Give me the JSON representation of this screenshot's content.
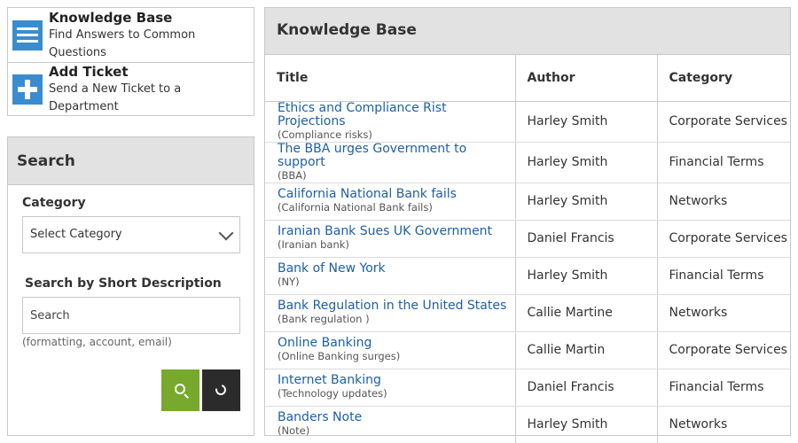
{
  "nav": {
    "items": [
      {
        "icon": "menu-icon",
        "title": "Knowledge Base",
        "subtitle": "Find Answers to Common Questions"
      },
      {
        "icon": "plus-icon",
        "title": "Add Ticket",
        "subtitle": "Send a New Ticket to a Department"
      }
    ]
  },
  "search": {
    "title": "Search",
    "category_label": "Category",
    "category_value": "Select Category",
    "desc_label": "Search by Short Description",
    "desc_placeholder": "Search",
    "hint": "(formatting, account, email)"
  },
  "kb": {
    "title": "Knowledge Base",
    "columns": [
      "Title",
      "Author",
      "Category"
    ],
    "rows": [
      {
        "title": "Ethics and Compliance Rist Projections",
        "sub": "(Compliance risks)",
        "author": "Harley Smith",
        "category": "Corporate Services"
      },
      {
        "title": "The BBA urges Government to support",
        "sub": "(BBA)",
        "author": "Harley Smith",
        "category": "Financial Terms"
      },
      {
        "title": "California National Bank fails",
        "sub": "(California National Bank fails)",
        "author": "Harley Smith",
        "category": "Networks"
      },
      {
        "title": "Iranian Bank Sues UK Government",
        "sub": "(Iranian bank)",
        "author": "Daniel Francis",
        "category": "Corporate Services"
      },
      {
        "title": "Bank of New York",
        "sub": "(NY)",
        "author": "Harley Smith",
        "category": "Financial Terms"
      },
      {
        "title": "Bank Regulation in the United States",
        "sub": "(Bank regulation )",
        "author": "Callie Martine",
        "category": "Networks"
      },
      {
        "title": "Online Banking",
        "sub": "(Online Banking surges)",
        "author": "Callie Martin",
        "category": "Corporate Services"
      },
      {
        "title": "Internet Banking",
        "sub": "(Technology updates)",
        "author": "Daniel Francis",
        "category": "Financial Terms"
      },
      {
        "title": "Banders Note",
        "sub": "(Note)",
        "author": "Harley Smith",
        "category": "Networks"
      }
    ]
  },
  "colors": {
    "accent": "#3a8ccf",
    "link": "#1d5fa8",
    "search_button": "#76a92c",
    "reset_button": "#2b2b2b"
  }
}
